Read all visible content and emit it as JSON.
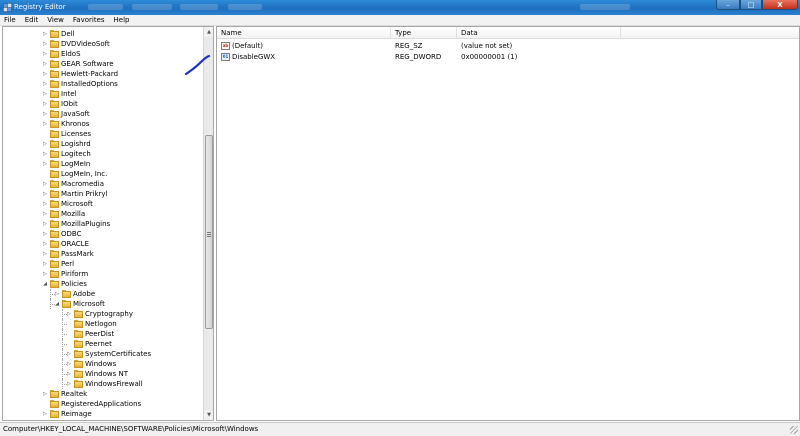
{
  "window": {
    "title": "Registry Editor",
    "controls": {
      "minimize": "–",
      "maximize": "□",
      "close": "X"
    }
  },
  "menu": [
    "File",
    "Edit",
    "View",
    "Favorites",
    "Help"
  ],
  "tree": {
    "items": [
      {
        "label": "Dell",
        "level": 0,
        "expander": "▷"
      },
      {
        "label": "DVDVideoSoft",
        "level": 0,
        "expander": "▷"
      },
      {
        "label": "EldoS",
        "level": 0,
        "expander": "▷"
      },
      {
        "label": "GEAR Software",
        "level": 0,
        "expander": "▷"
      },
      {
        "label": "Hewlett-Packard",
        "level": 0,
        "expander": "▷"
      },
      {
        "label": "InstalledOptions",
        "level": 0,
        "expander": "▷"
      },
      {
        "label": "Intel",
        "level": 0,
        "expander": "▷"
      },
      {
        "label": "IObit",
        "level": 0,
        "expander": "▷"
      },
      {
        "label": "JavaSoft",
        "level": 0,
        "expander": "▷"
      },
      {
        "label": "Khronos",
        "level": 0,
        "expander": "▷"
      },
      {
        "label": "Licenses",
        "level": 0,
        "expander": ""
      },
      {
        "label": "Logishrd",
        "level": 0,
        "expander": "▷"
      },
      {
        "label": "Logitech",
        "level": 0,
        "expander": "▷"
      },
      {
        "label": "LogMeIn",
        "level": 0,
        "expander": "▷"
      },
      {
        "label": "LogMeIn, Inc.",
        "level": 0,
        "expander": ""
      },
      {
        "label": "Macromedia",
        "level": 0,
        "expander": "▷"
      },
      {
        "label": "Martin Prikryl",
        "level": 0,
        "expander": "▷"
      },
      {
        "label": "Microsoft",
        "level": 0,
        "expander": "▷"
      },
      {
        "label": "Mozilla",
        "level": 0,
        "expander": "▷"
      },
      {
        "label": "MozillaPlugins",
        "level": 0,
        "expander": "▷"
      },
      {
        "label": "ODBC",
        "level": 0,
        "expander": "▷"
      },
      {
        "label": "ORACLE",
        "level": 0,
        "expander": "▷"
      },
      {
        "label": "PassMark",
        "level": 0,
        "expander": "▷"
      },
      {
        "label": "Perl",
        "level": 0,
        "expander": "▷"
      },
      {
        "label": "Piriform",
        "level": 0,
        "expander": "▷"
      },
      {
        "label": "Policies",
        "level": 0,
        "expander": "◢"
      },
      {
        "label": "Adobe",
        "level": 1,
        "expander": "▷"
      },
      {
        "label": "Microsoft",
        "level": 1,
        "expander": "◢"
      },
      {
        "label": "Cryptography",
        "level": 2,
        "expander": "▷"
      },
      {
        "label": "Netlogon",
        "level": 2,
        "expander": ""
      },
      {
        "label": "PeerDist",
        "level": 2,
        "expander": ""
      },
      {
        "label": "Peernet",
        "level": 2,
        "expander": ""
      },
      {
        "label": "SystemCertificates",
        "level": 2,
        "expander": "▷"
      },
      {
        "label": "Windows",
        "level": 2,
        "expander": "▷"
      },
      {
        "label": "Windows NT",
        "level": 2,
        "expander": "▷"
      },
      {
        "label": "WindowsFirewall",
        "level": 2,
        "expander": "▷"
      },
      {
        "label": "Realtek",
        "level": 0,
        "expander": "▷"
      },
      {
        "label": "RegisteredApplications",
        "level": 0,
        "expander": ""
      },
      {
        "label": "Reimage",
        "level": 0,
        "expander": "▷"
      }
    ]
  },
  "list": {
    "columns": [
      "Name",
      "Type",
      "Data"
    ],
    "rows": [
      {
        "icon": "string-value-icon",
        "name": "(Default)",
        "type": "REG_SZ",
        "data": "(value not set)"
      },
      {
        "icon": "dword-value-icon",
        "name": "DisableGWX",
        "type": "REG_DWORD",
        "data": "0x00000001 (1)"
      }
    ]
  },
  "status": {
    "path": "Computer\\HKEY_LOCAL_MACHINE\\SOFTWARE\\Policies\\Microsoft\\Windows"
  },
  "colors": {
    "titlebar": "#1f6fbf",
    "annotation_stroke": "#1a2fc4"
  }
}
